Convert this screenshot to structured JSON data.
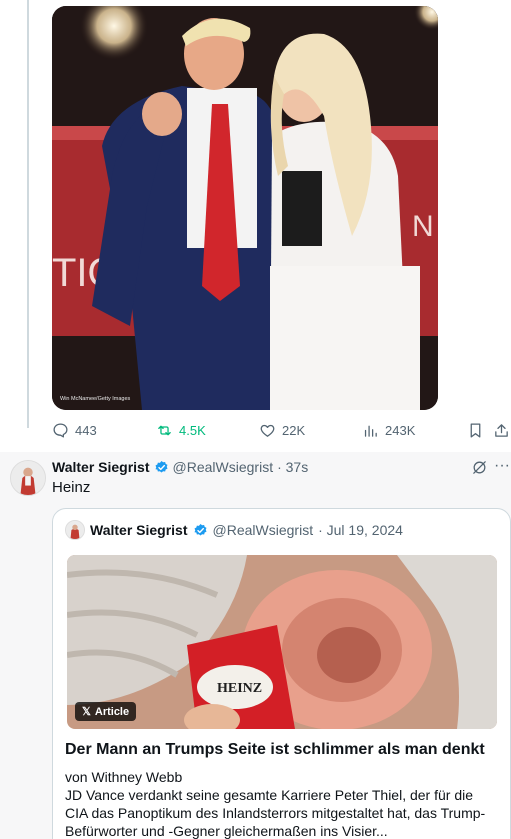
{
  "top_tweet": {
    "photo_credit": "Win McNamee/Getty Images",
    "stage_text_left": "TIO",
    "stage_text_right": "N U",
    "actions": {
      "replies": "443",
      "reposts": "4.5K",
      "likes": "22K",
      "views": "243K"
    }
  },
  "tweet": {
    "author_name": "Walter Siegrist",
    "handle": "@RealWsiegrist",
    "time": "· 37s",
    "text": "Heinz"
  },
  "quoted_tweet": {
    "author_name": "Walter Siegrist",
    "handle": "@RealWsiegrist",
    "date": "· Jul 19, 2024",
    "article_badge": "Article",
    "packet_label": "HEINZ",
    "article_title": "Der Mann an Trumps Seite ist schlimmer als man denkt",
    "byline": "von Withney Webb",
    "excerpt": "JD Vance verdankt seine gesamte Karriere Peter Thiel, der für die CIA das Panoptikum des Inlandsterrors mitgestaltet hat, das Trump-Befürworter und -Gegner gleichermaßen ins Visier..."
  },
  "colors": {
    "accent_blue": "#1d9bf0",
    "repost_green": "#00ba7c",
    "muted": "#536471"
  }
}
